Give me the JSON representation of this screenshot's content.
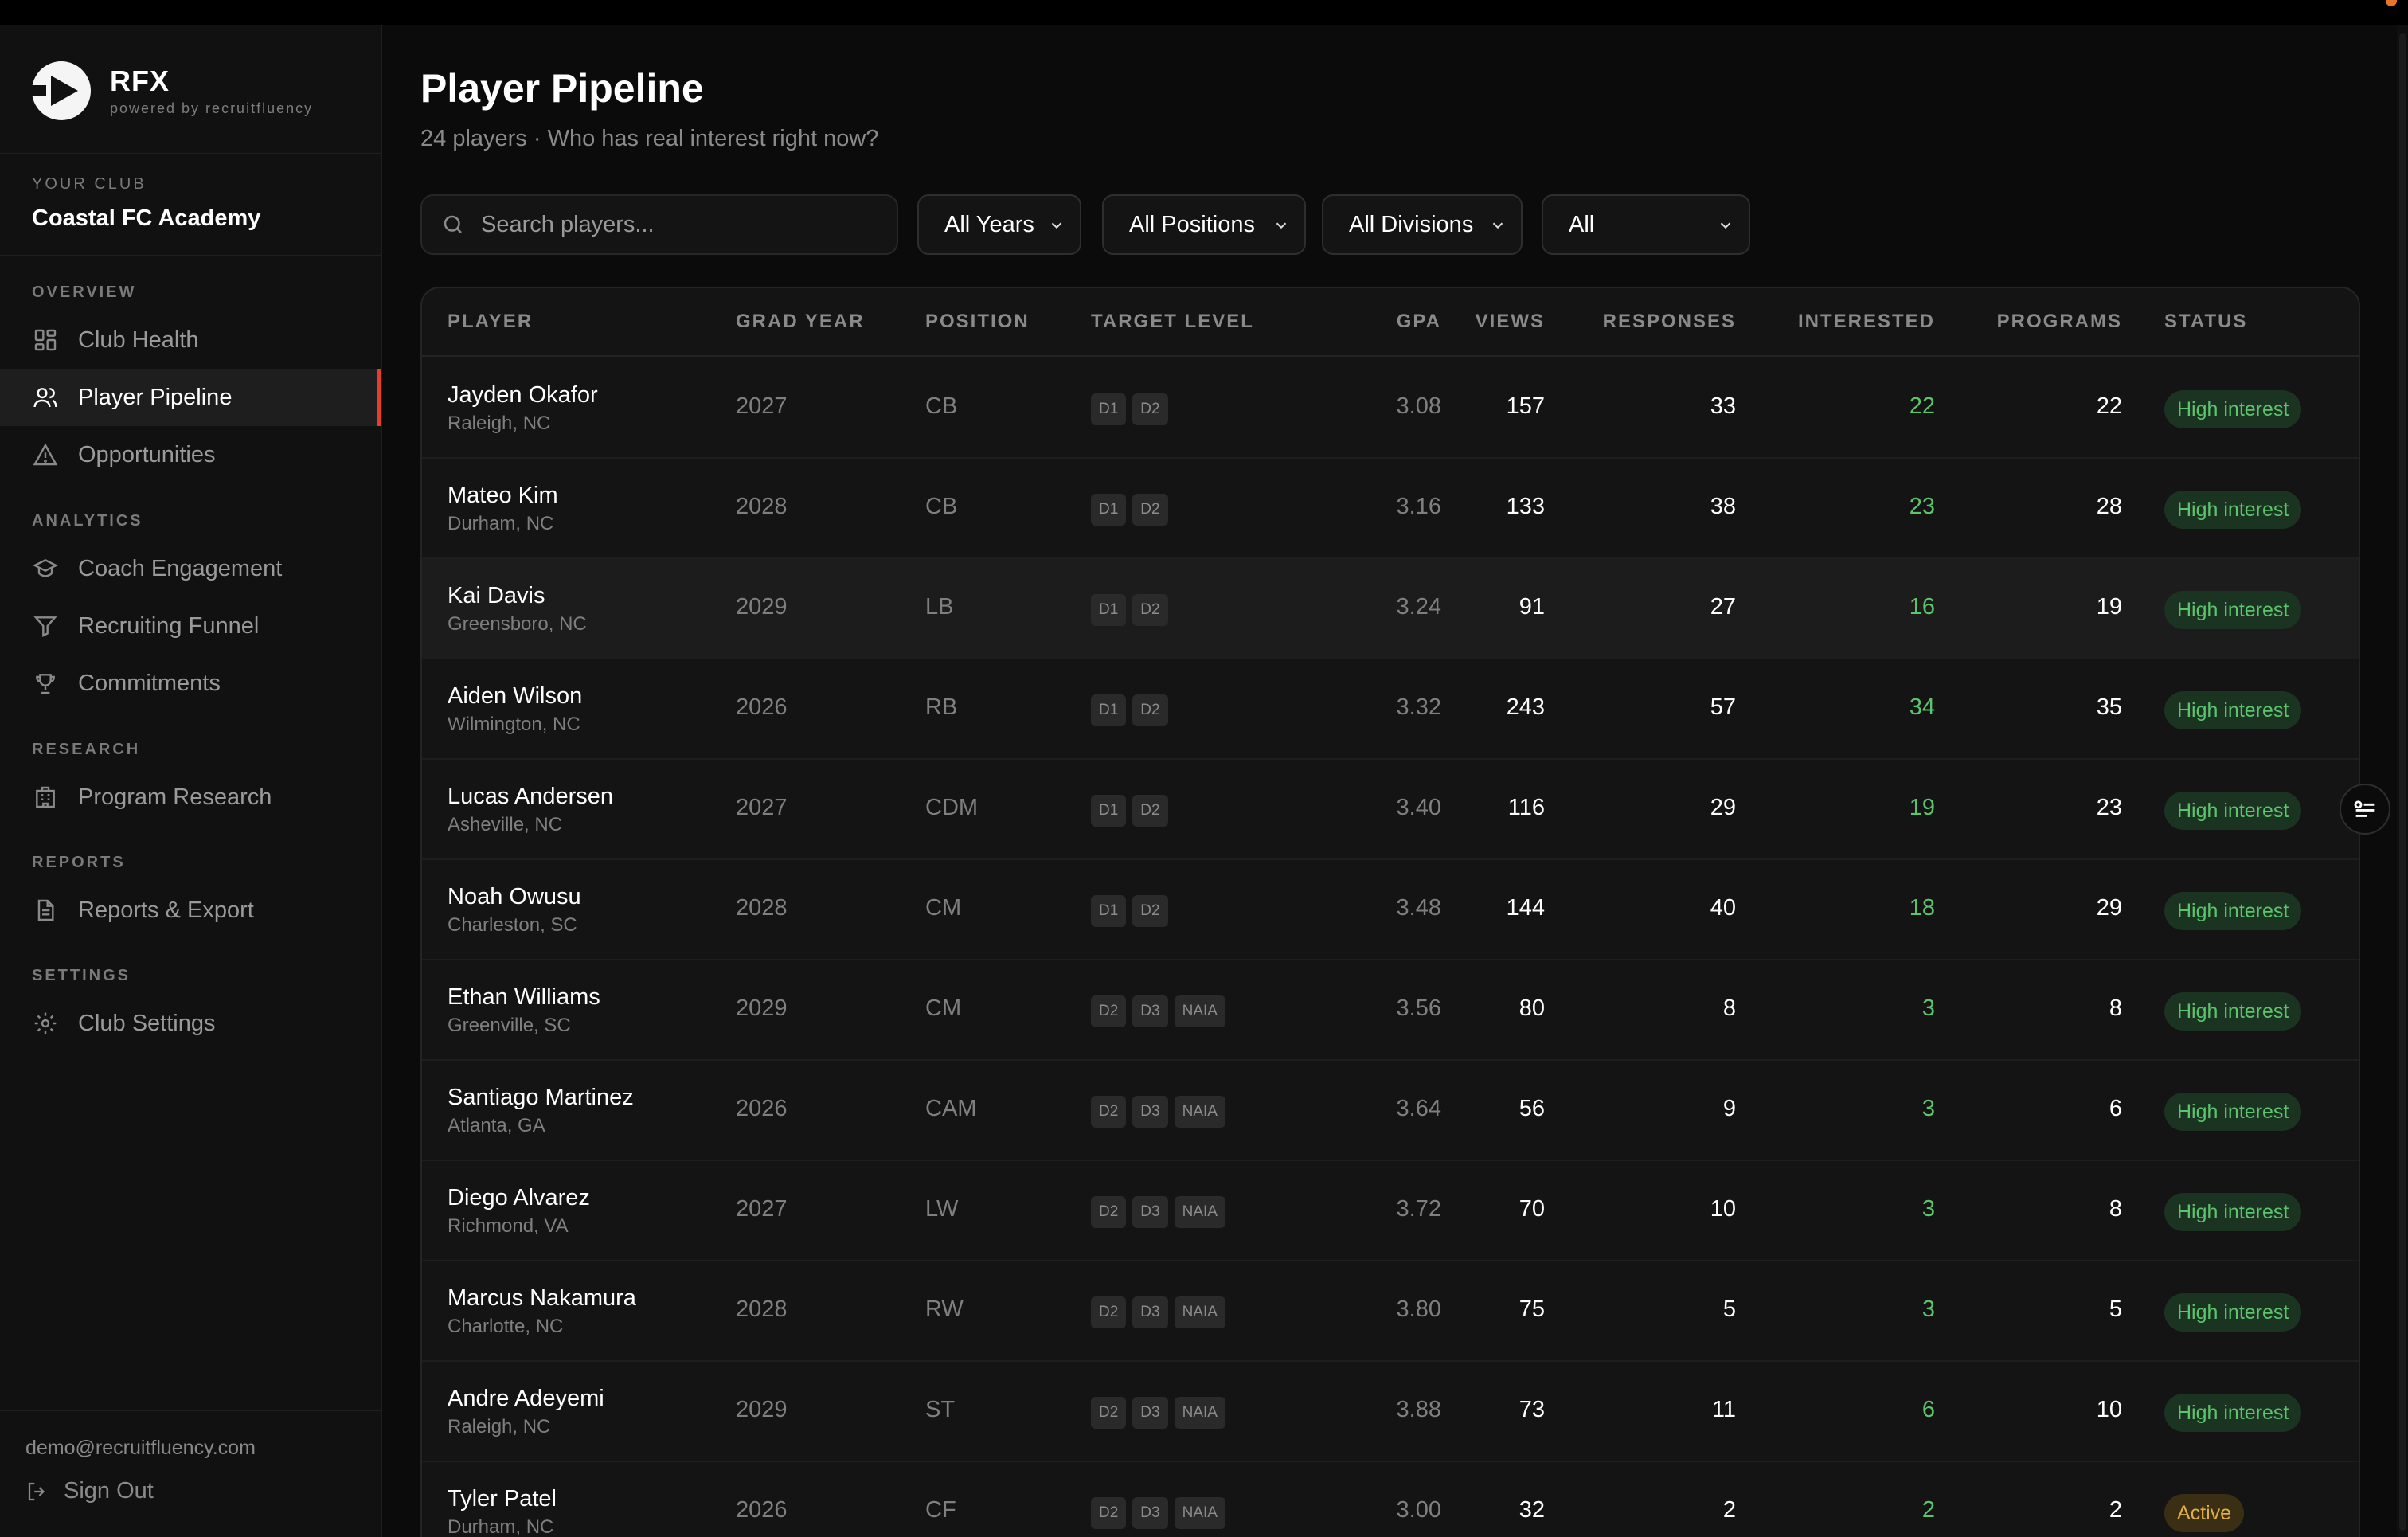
{
  "brand": {
    "name": "RFX",
    "sub": "powered by recruitfluency"
  },
  "club": {
    "label": "YOUR CLUB",
    "name": "Coastal FC Academy"
  },
  "nav": {
    "overview": "OVERVIEW",
    "analytics": "ANALYTICS",
    "research": "RESEARCH",
    "reports": "REPORTS",
    "settings": "SETTINGS",
    "items": [
      {
        "label": "Club Health",
        "icon": "grid-icon"
      },
      {
        "label": "Player Pipeline",
        "icon": "users-icon",
        "active": true
      },
      {
        "label": "Opportunities",
        "icon": "warning-icon"
      },
      {
        "label": "Coach Engagement",
        "icon": "graduation-cap-icon"
      },
      {
        "label": "Recruiting Funnel",
        "icon": "funnel-icon"
      },
      {
        "label": "Commitments",
        "icon": "trophy-icon"
      },
      {
        "label": "Program Research",
        "icon": "building-icon"
      },
      {
        "label": "Reports & Export",
        "icon": "document-icon"
      },
      {
        "label": "Club Settings",
        "icon": "gear-icon"
      }
    ]
  },
  "footer": {
    "email": "demo@recruitfluency.com",
    "signout": "Sign Out"
  },
  "page": {
    "title": "Player Pipeline",
    "subtitle": "24 players · Who has real interest right now?"
  },
  "filters": {
    "search_placeholder": "Search players...",
    "years": "All Years",
    "positions": "All Positions",
    "divisions": "All Divisions",
    "status": "All"
  },
  "table": {
    "headers": [
      "PLAYER",
      "GRAD YEAR",
      "POSITION",
      "TARGET LEVEL",
      "GPA",
      "VIEWS",
      "RESPONSES",
      "INTERESTED",
      "PROGRAMS",
      "STATUS"
    ],
    "rows": [
      {
        "name": "Jayden Okafor",
        "loc": "Raleigh, NC",
        "year": "2027",
        "pos": "CB",
        "levels": [
          "D1",
          "D2"
        ],
        "gpa": "3.08",
        "views": "157",
        "responses": "33",
        "interested": "22",
        "programs": "22",
        "status": "High interest",
        "status_type": "high"
      },
      {
        "name": "Mateo Kim",
        "loc": "Durham, NC",
        "year": "2028",
        "pos": "CB",
        "levels": [
          "D1",
          "D2"
        ],
        "gpa": "3.16",
        "views": "133",
        "responses": "38",
        "interested": "23",
        "programs": "28",
        "status": "High interest",
        "status_type": "high"
      },
      {
        "name": "Kai Davis",
        "loc": "Greensboro, NC",
        "year": "2029",
        "pos": "LB",
        "levels": [
          "D1",
          "D2"
        ],
        "gpa": "3.24",
        "views": "91",
        "responses": "27",
        "interested": "16",
        "programs": "19",
        "status": "High interest",
        "status_type": "high"
      },
      {
        "name": "Aiden Wilson",
        "loc": "Wilmington, NC",
        "year": "2026",
        "pos": "RB",
        "levels": [
          "D1",
          "D2"
        ],
        "gpa": "3.32",
        "views": "243",
        "responses": "57",
        "interested": "34",
        "programs": "35",
        "status": "High interest",
        "status_type": "high"
      },
      {
        "name": "Lucas Andersen",
        "loc": "Asheville, NC",
        "year": "2027",
        "pos": "CDM",
        "levels": [
          "D1",
          "D2"
        ],
        "gpa": "3.40",
        "views": "116",
        "responses": "29",
        "interested": "19",
        "programs": "23",
        "status": "High interest",
        "status_type": "high"
      },
      {
        "name": "Noah Owusu",
        "loc": "Charleston, SC",
        "year": "2028",
        "pos": "CM",
        "levels": [
          "D1",
          "D2"
        ],
        "gpa": "3.48",
        "views": "144",
        "responses": "40",
        "interested": "18",
        "programs": "29",
        "status": "High interest",
        "status_type": "high"
      },
      {
        "name": "Ethan Williams",
        "loc": "Greenville, SC",
        "year": "2029",
        "pos": "CM",
        "levels": [
          "D2",
          "D3",
          "NAIA"
        ],
        "gpa": "3.56",
        "views": "80",
        "responses": "8",
        "interested": "3",
        "programs": "8",
        "status": "High interest",
        "status_type": "high"
      },
      {
        "name": "Santiago Martinez",
        "loc": "Atlanta, GA",
        "year": "2026",
        "pos": "CAM",
        "levels": [
          "D2",
          "D3",
          "NAIA"
        ],
        "gpa": "3.64",
        "views": "56",
        "responses": "9",
        "interested": "3",
        "programs": "6",
        "status": "High interest",
        "status_type": "high"
      },
      {
        "name": "Diego Alvarez",
        "loc": "Richmond, VA",
        "year": "2027",
        "pos": "LW",
        "levels": [
          "D2",
          "D3",
          "NAIA"
        ],
        "gpa": "3.72",
        "views": "70",
        "responses": "10",
        "interested": "3",
        "programs": "8",
        "status": "High interest",
        "status_type": "high"
      },
      {
        "name": "Marcus Nakamura",
        "loc": "Charlotte, NC",
        "year": "2028",
        "pos": "RW",
        "levels": [
          "D2",
          "D3",
          "NAIA"
        ],
        "gpa": "3.80",
        "views": "75",
        "responses": "5",
        "interested": "3",
        "programs": "5",
        "status": "High interest",
        "status_type": "high"
      },
      {
        "name": "Andre Adeyemi",
        "loc": "Raleigh, NC",
        "year": "2029",
        "pos": "ST",
        "levels": [
          "D2",
          "D3",
          "NAIA"
        ],
        "gpa": "3.88",
        "views": "73",
        "responses": "11",
        "interested": "6",
        "programs": "10",
        "status": "High interest",
        "status_type": "high"
      },
      {
        "name": "Tyler Patel",
        "loc": "Durham, NC",
        "year": "2026",
        "pos": "CF",
        "levels": [
          "D2",
          "D3",
          "NAIA"
        ],
        "gpa": "3.00",
        "views": "32",
        "responses": "2",
        "interested": "2",
        "programs": "2",
        "status": "Active",
        "status_type": "active"
      }
    ]
  }
}
